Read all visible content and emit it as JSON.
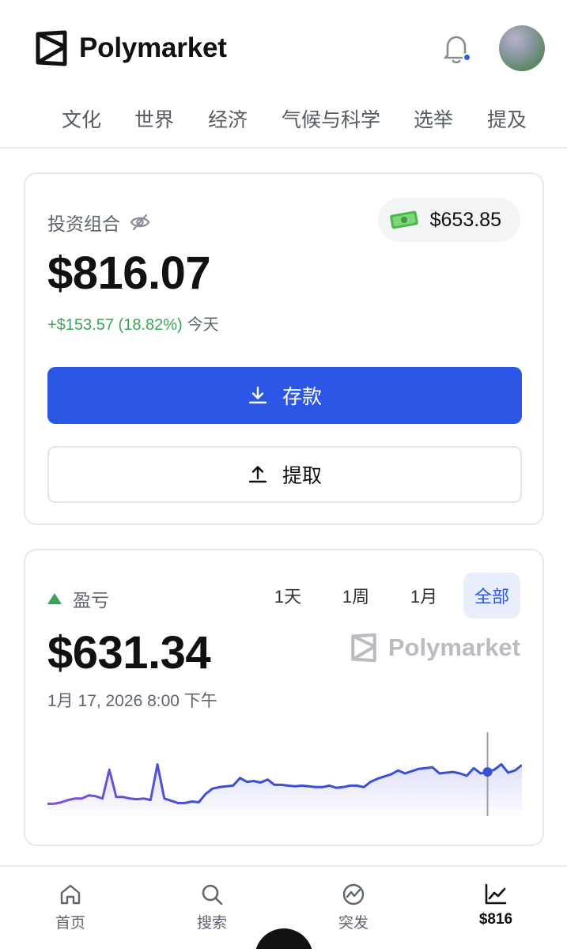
{
  "header": {
    "brand": "Polymarket",
    "notification_unread": true
  },
  "categories": [
    "文化",
    "世界",
    "经济",
    "气候与科学",
    "选举",
    "提及"
  ],
  "portfolio": {
    "label": "投资组合",
    "cash": "$653.85",
    "value": "$816.07",
    "change": "+$153.57 (18.82%)",
    "change_period": "今天",
    "deposit_label": "存款",
    "withdraw_label": "提取"
  },
  "pnl": {
    "label": "盈亏",
    "ranges": [
      "1天",
      "1周",
      "1月",
      "全部"
    ],
    "active_range": "全部",
    "value": "$631.34",
    "watermark": "Polymarket",
    "date": "1月 17, 2026 8:00 下午"
  },
  "chart_data": {
    "type": "area",
    "x_label": "",
    "y_label": "",
    "values": [
      0.1,
      0.1,
      0.12,
      0.15,
      0.17,
      0.17,
      0.21,
      0.2,
      0.17,
      0.55,
      0.19,
      0.19,
      0.17,
      0.16,
      0.17,
      0.15,
      0.62,
      0.17,
      0.14,
      0.11,
      0.11,
      0.13,
      0.12,
      0.23,
      0.3,
      0.32,
      0.33,
      0.34,
      0.44,
      0.39,
      0.4,
      0.38,
      0.42,
      0.35,
      0.35,
      0.34,
      0.33,
      0.34,
      0.33,
      0.32,
      0.32,
      0.34,
      0.31,
      0.32,
      0.34,
      0.34,
      0.32,
      0.39,
      0.43,
      0.46,
      0.49,
      0.54,
      0.5,
      0.53,
      0.56,
      0.57,
      0.58,
      0.5,
      0.51,
      0.52,
      0.5,
      0.47,
      0.57,
      0.5,
      0.52,
      0.55,
      0.62,
      0.51,
      0.54,
      0.61
    ],
    "line_color": "#3a4fd8",
    "start_color": "#8a4fd6",
    "marker_index": 64,
    "ylim": [
      0,
      1
    ]
  },
  "nav": [
    {
      "label": "首页",
      "icon": "home-icon"
    },
    {
      "label": "搜索",
      "icon": "search-icon"
    },
    {
      "label": "突发",
      "icon": "trending-icon"
    },
    {
      "label": "$816",
      "icon": "chart-icon"
    }
  ],
  "colors": {
    "accent": "#2c57e6",
    "positive": "#3aa35a"
  }
}
